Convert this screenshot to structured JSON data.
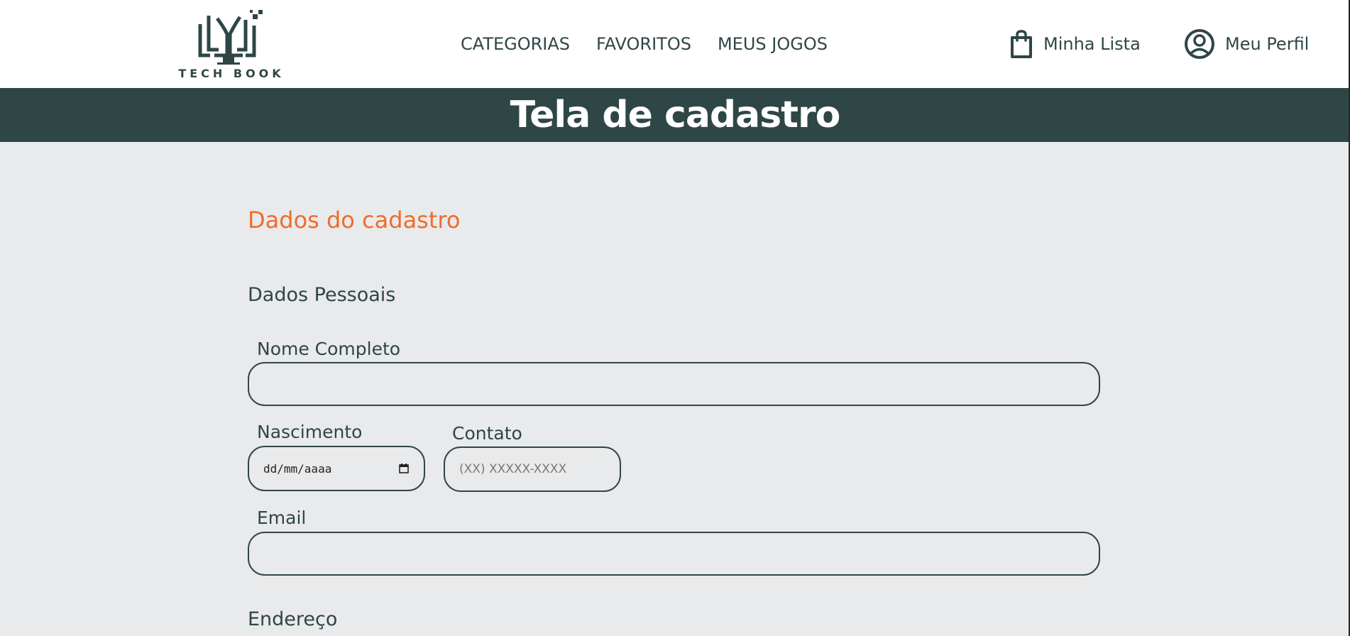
{
  "header": {
    "logo_text": "TECH BOOK",
    "nav": [
      "CATEGORIAS",
      "FAVORITOS",
      "MEUS JOGOS"
    ],
    "cart_label": "Minha Lista",
    "profile_label": "Meu Perfil"
  },
  "banner": {
    "title": "Tela de cadastro"
  },
  "form": {
    "section_title": "Dados do cadastro",
    "personal_title": "Dados Pessoais",
    "name_label": "Nome Completo",
    "name_value": "",
    "birth_label": "Nascimento",
    "birth_placeholder": "dd/mm/aaaa",
    "contact_label": "Contato",
    "contact_placeholder": "(XX) XXXXX-XXXX",
    "email_label": "Email",
    "email_value": "",
    "address_title": "Endereço"
  },
  "colors": {
    "brand_dark": "#2f4646",
    "accent": "#ef6c2b",
    "background": "#e9eaeb"
  },
  "icons": {
    "logo": "book-logo-icon",
    "cart": "shopping-bag-icon",
    "profile": "user-circle-icon",
    "date": "calendar-icon"
  }
}
